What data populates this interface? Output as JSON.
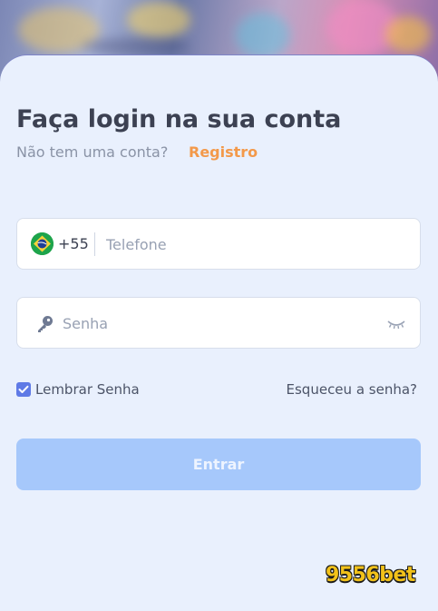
{
  "login": {
    "title": "Faça login na sua conta",
    "no_account_text": "Não tem uma conta?",
    "register_link": "Registro",
    "phone": {
      "country_flag": "brazil-flag-icon",
      "dial_code": "+55",
      "placeholder": "Telefone",
      "value": ""
    },
    "password": {
      "placeholder": "Senha",
      "value": "",
      "leading_icon": "key-icon",
      "toggle_icon": "eye-closed-icon"
    },
    "remember": {
      "label": "Lembrar Senha",
      "checked": true
    },
    "forgot_link": "Esqueceu a senha?",
    "submit_label": "Entrar"
  },
  "brand": {
    "watermark": "9556bet"
  },
  "colors": {
    "accent_orange": "#f3994a",
    "checkbox_blue": "#5f7ae6",
    "submit_disabled": "#a6c8fb",
    "sheet_background": "#e9f0fd",
    "text_dark": "#3c4152"
  }
}
